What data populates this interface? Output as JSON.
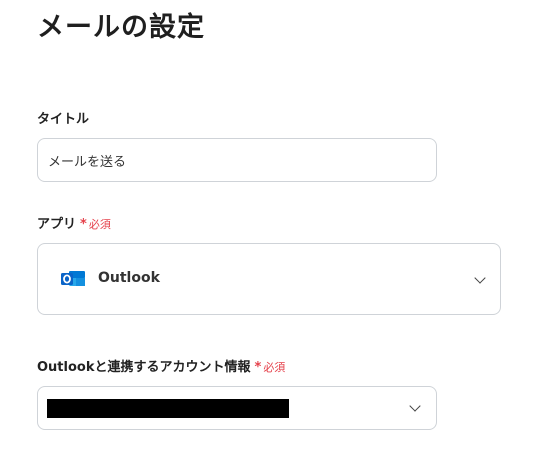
{
  "page": {
    "title": "メールの設定"
  },
  "title_field": {
    "label": "タイトル",
    "value": "メールを送る"
  },
  "app_field": {
    "label": "アプリ",
    "required_mark": "*",
    "required_text": "必須",
    "selected_app": "Outlook",
    "selected_app_icon": "outlook-icon",
    "dropdown_icon": "chevron-down-icon"
  },
  "account_field": {
    "label": "Outlookと連携するアカウント情報",
    "required_mark": "*",
    "required_text": "必須",
    "value_redacted": true,
    "dropdown_icon": "chevron-down-icon"
  },
  "colors": {
    "required": "#e5414b",
    "border": "#cfd3d8",
    "outlook_blue": "#0a64c8"
  }
}
